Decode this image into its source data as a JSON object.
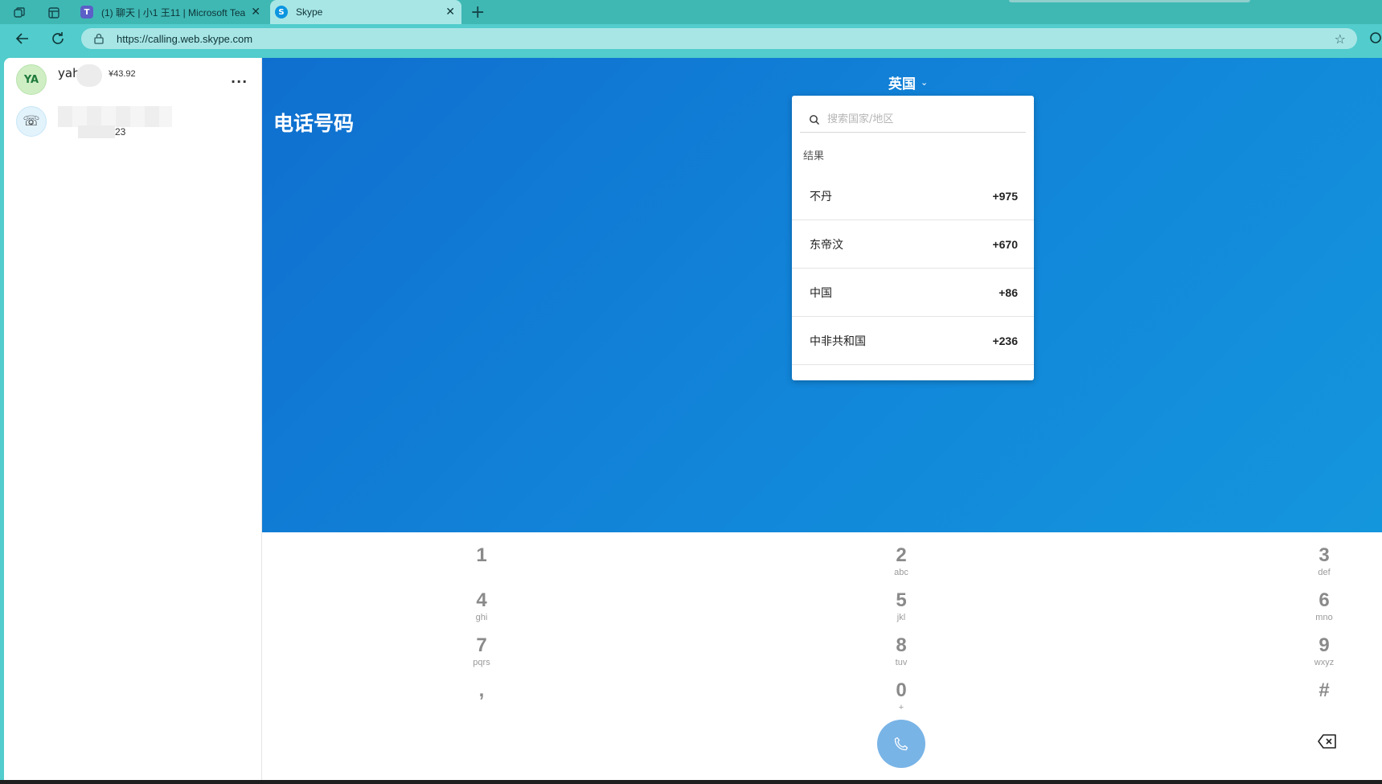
{
  "browser": {
    "tabs": [
      {
        "label": "(1) 聊天 | 小1 王11 | Microsoft Tea",
        "favicon": "teams-icon"
      },
      {
        "label": "Skype",
        "favicon": "skype-icon"
      }
    ],
    "url": "https://calling.web.skype.com"
  },
  "sidebar": {
    "profile": {
      "initials": "YA",
      "name": "yah",
      "balance": "¥43.92",
      "more": "..."
    },
    "contact": {
      "number_suffix": "23"
    }
  },
  "main": {
    "title": "电话号码",
    "country_selected": "英国",
    "dropdown": {
      "search_placeholder": "搜索国家/地区",
      "results_label": "结果",
      "items": [
        {
          "name": "不丹",
          "code": "+975"
        },
        {
          "name": "东帝汶",
          "code": "+670"
        },
        {
          "name": "中国",
          "code": "+86"
        },
        {
          "name": "中非共和国",
          "code": "+236"
        }
      ]
    }
  },
  "keypad": {
    "keys": [
      {
        "digit": "1",
        "letters": ""
      },
      {
        "digit": "2",
        "letters": "abc"
      },
      {
        "digit": "3",
        "letters": "def"
      },
      {
        "digit": "4",
        "letters": "ghi"
      },
      {
        "digit": "5",
        "letters": "jkl"
      },
      {
        "digit": "6",
        "letters": "mno"
      },
      {
        "digit": "7",
        "letters": "pqrs"
      },
      {
        "digit": "8",
        "letters": "tuv"
      },
      {
        "digit": "9",
        "letters": "wxyz"
      },
      {
        "digit": ",",
        "letters": ""
      },
      {
        "digit": "0",
        "letters": "+"
      },
      {
        "digit": "#",
        "letters": ""
      }
    ]
  },
  "colors": {
    "tabbar": "#3fb8b4",
    "addressbar": "#52cccc",
    "brand_blue": "#0f6fcf",
    "call_button": "#79b4e6"
  }
}
